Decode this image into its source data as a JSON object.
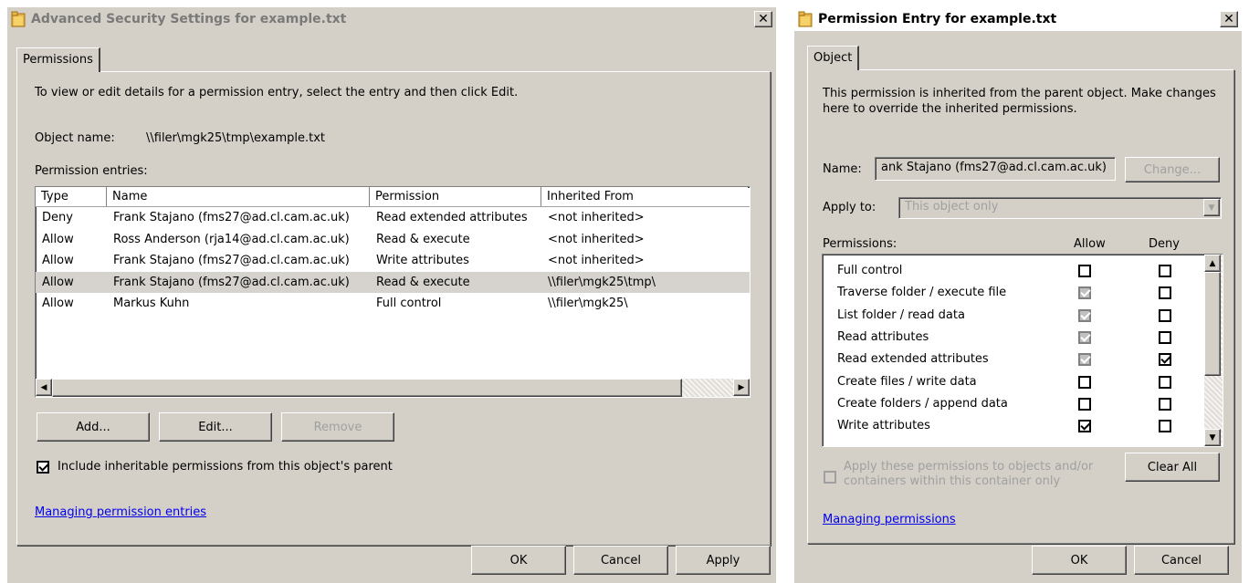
{
  "left": {
    "title": "Advanced Security Settings for example.txt",
    "close_glyph": "✕",
    "tab": "Permissions",
    "instruction": "To view or edit details for a permission entry, select the entry and then click Edit.",
    "object_name_label": "Object name:",
    "object_name_value": "\\\\filer\\mgk25\\tmp\\example.txt",
    "entries_label": "Permission entries:",
    "columns": [
      "Type",
      "Name",
      "Permission",
      "Inherited From"
    ],
    "rows": [
      {
        "type": "Deny",
        "name": "Frank Stajano (fms27@ad.cl.cam.ac.uk)",
        "permission": "Read extended attributes",
        "inherited": "<not inherited>"
      },
      {
        "type": "Allow",
        "name": "Ross Anderson (rja14@ad.cl.cam.ac.uk)",
        "permission": "Read & execute",
        "inherited": "<not inherited>"
      },
      {
        "type": "Allow",
        "name": "Frank Stajano (fms27@ad.cl.cam.ac.uk)",
        "permission": "Write attributes",
        "inherited": "<not inherited>"
      },
      {
        "type": "Allow",
        "name": "Frank Stajano (fms27@ad.cl.cam.ac.uk)",
        "permission": "Read & execute",
        "inherited": "\\\\filer\\mgk25\\tmp\\"
      },
      {
        "type": "Allow",
        "name": "Markus Kuhn",
        "permission": "Full control",
        "inherited": "\\\\filer\\mgk25\\"
      }
    ],
    "add_label": "Add...",
    "edit_label": "Edit...",
    "remove_label": "Remove",
    "include_inheritable": "Include inheritable permissions from this object's parent",
    "managing_link": "Managing permission entries",
    "ok_label": "OK",
    "cancel_label": "Cancel",
    "apply_label": "Apply",
    "scroll_left": "◀",
    "scroll_right": "▶"
  },
  "right": {
    "title": "Permission Entry for example.txt",
    "close_glyph": "✕",
    "tab": "Object",
    "info": "This permission is inherited from the parent object. Make changes here to override the inherited permissions.",
    "name_label": "Name:",
    "name_value": "ank Stajano (fms27@ad.cl.cam.ac.uk)",
    "change_label": "Change...",
    "apply_to_label": "Apply to:",
    "apply_to_value": "This object only",
    "permissions_label": "Permissions:",
    "allow_label": "Allow",
    "deny_label": "Deny",
    "permissions": [
      {
        "label": "Full control",
        "allow": "empty",
        "deny": "empty"
      },
      {
        "label": "Traverse folder / execute file",
        "allow": "gray-check",
        "deny": "empty"
      },
      {
        "label": "List folder / read data",
        "allow": "gray-check",
        "deny": "empty"
      },
      {
        "label": "Read attributes",
        "allow": "gray-check",
        "deny": "empty"
      },
      {
        "label": "Read extended attributes",
        "allow": "gray-check",
        "deny": "check"
      },
      {
        "label": "Create files / write data",
        "allow": "empty",
        "deny": "empty"
      },
      {
        "label": "Create folders / append data",
        "allow": "empty",
        "deny": "empty"
      },
      {
        "label": "Write attributes",
        "allow": "check",
        "deny": "empty"
      }
    ],
    "apply_children": "Apply these permissions to objects and/or containers within this container only",
    "clear_all_label": "Clear All",
    "managing_link": "Managing permissions",
    "ok_label": "OK",
    "cancel_label": "Cancel",
    "scroll_up": "▲",
    "scroll_down": "▼",
    "dropdown_arrow": "▼"
  },
  "colors": {
    "dialog_bg": "#d4d0c8",
    "left_title_bg": "#d4d0c8",
    "right_title_bg": "#ffffff",
    "link": "#0000ee",
    "selected_row": "#d6d3ce"
  }
}
